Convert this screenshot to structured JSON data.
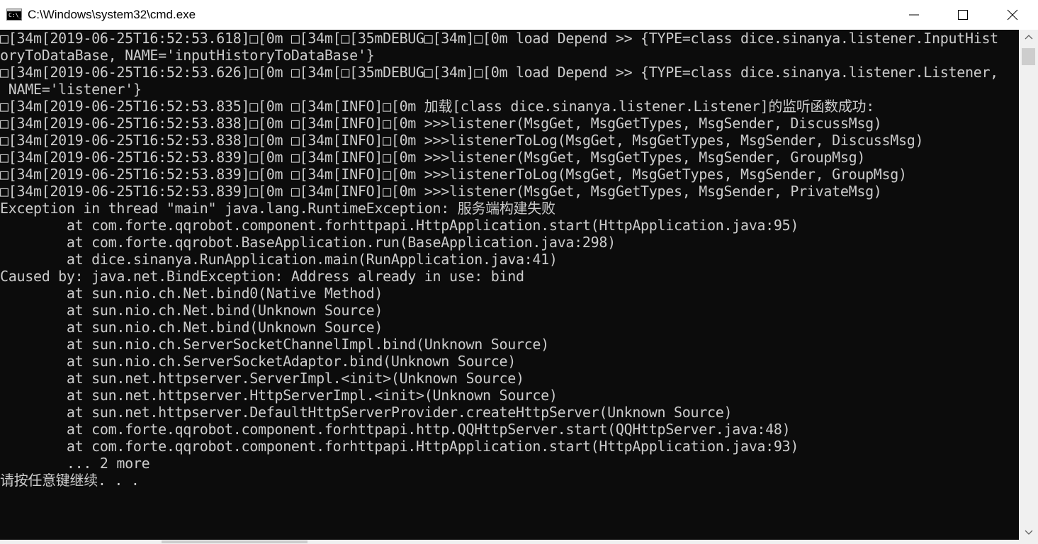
{
  "window": {
    "title": "C:\\Windows\\system32\\cmd.exe",
    "icon": "cmd-icon",
    "buttons": {
      "minimize": "minimize-icon",
      "maximize": "maximize-icon",
      "close": "close-icon"
    }
  },
  "console": {
    "background": "#0c0c0c",
    "foreground": "#cccccc",
    "lines": [
      "□[34m[2019-06-25T16:52:53.618]□[0m □[34m[□[35mDEBUG□[34m]□[0m load Depend >> {TYPE=class dice.sinanya.listener.InputHist",
      "oryToDataBase, NAME='inputHistoryToDataBase'}",
      "□[34m[2019-06-25T16:52:53.626]□[0m □[34m[□[35mDEBUG□[34m]□[0m load Depend >> {TYPE=class dice.sinanya.listener.Listener,",
      " NAME='listener'}",
      "□[34m[2019-06-25T16:52:53.835]□[0m □[34m[INFO]□[0m 加载[class dice.sinanya.listener.Listener]的监听函数成功:",
      "□[34m[2019-06-25T16:52:53.838]□[0m □[34m[INFO]□[0m >>>listener(MsgGet, MsgGetTypes, MsgSender, DiscussMsg)",
      "□[34m[2019-06-25T16:52:53.838]□[0m □[34m[INFO]□[0m >>>listenerToLog(MsgGet, MsgGetTypes, MsgSender, DiscussMsg)",
      "□[34m[2019-06-25T16:52:53.839]□[0m □[34m[INFO]□[0m >>>listener(MsgGet, MsgGetTypes, MsgSender, GroupMsg)",
      "□[34m[2019-06-25T16:52:53.839]□[0m □[34m[INFO]□[0m >>>listenerToLog(MsgGet, MsgGetTypes, MsgSender, GroupMsg)",
      "□[34m[2019-06-25T16:52:53.839]□[0m □[34m[INFO]□[0m >>>listener(MsgGet, MsgGetTypes, MsgSender, PrivateMsg)",
      "Exception in thread \"main\" java.lang.RuntimeException: 服务端构建失败",
      "        at com.forte.qqrobot.component.forhttpapi.HttpApplication.start(HttpApplication.java:95)",
      "        at com.forte.qqrobot.BaseApplication.run(BaseApplication.java:298)",
      "        at dice.sinanya.RunApplication.main(RunApplication.java:41)",
      "Caused by: java.net.BindException: Address already in use: bind",
      "        at sun.nio.ch.Net.bind0(Native Method)",
      "        at sun.nio.ch.Net.bind(Unknown Source)",
      "        at sun.nio.ch.Net.bind(Unknown Source)",
      "        at sun.nio.ch.ServerSocketChannelImpl.bind(Unknown Source)",
      "        at sun.nio.ch.ServerSocketAdaptor.bind(Unknown Source)",
      "        at sun.net.httpserver.ServerImpl.<init>(Unknown Source)",
      "        at sun.net.httpserver.HttpServerImpl.<init>(Unknown Source)",
      "        at sun.net.httpserver.DefaultHttpServerProvider.createHttpServer(Unknown Source)",
      "        at com.forte.qqrobot.component.forhttpapi.http.QQHttpServer.start(QQHttpServer.java:48)",
      "        at com.forte.qqrobot.component.forhttpapi.HttpApplication.start(HttpApplication.java:93)",
      "        ... 2 more",
      "请按任意键继续. . ."
    ]
  }
}
